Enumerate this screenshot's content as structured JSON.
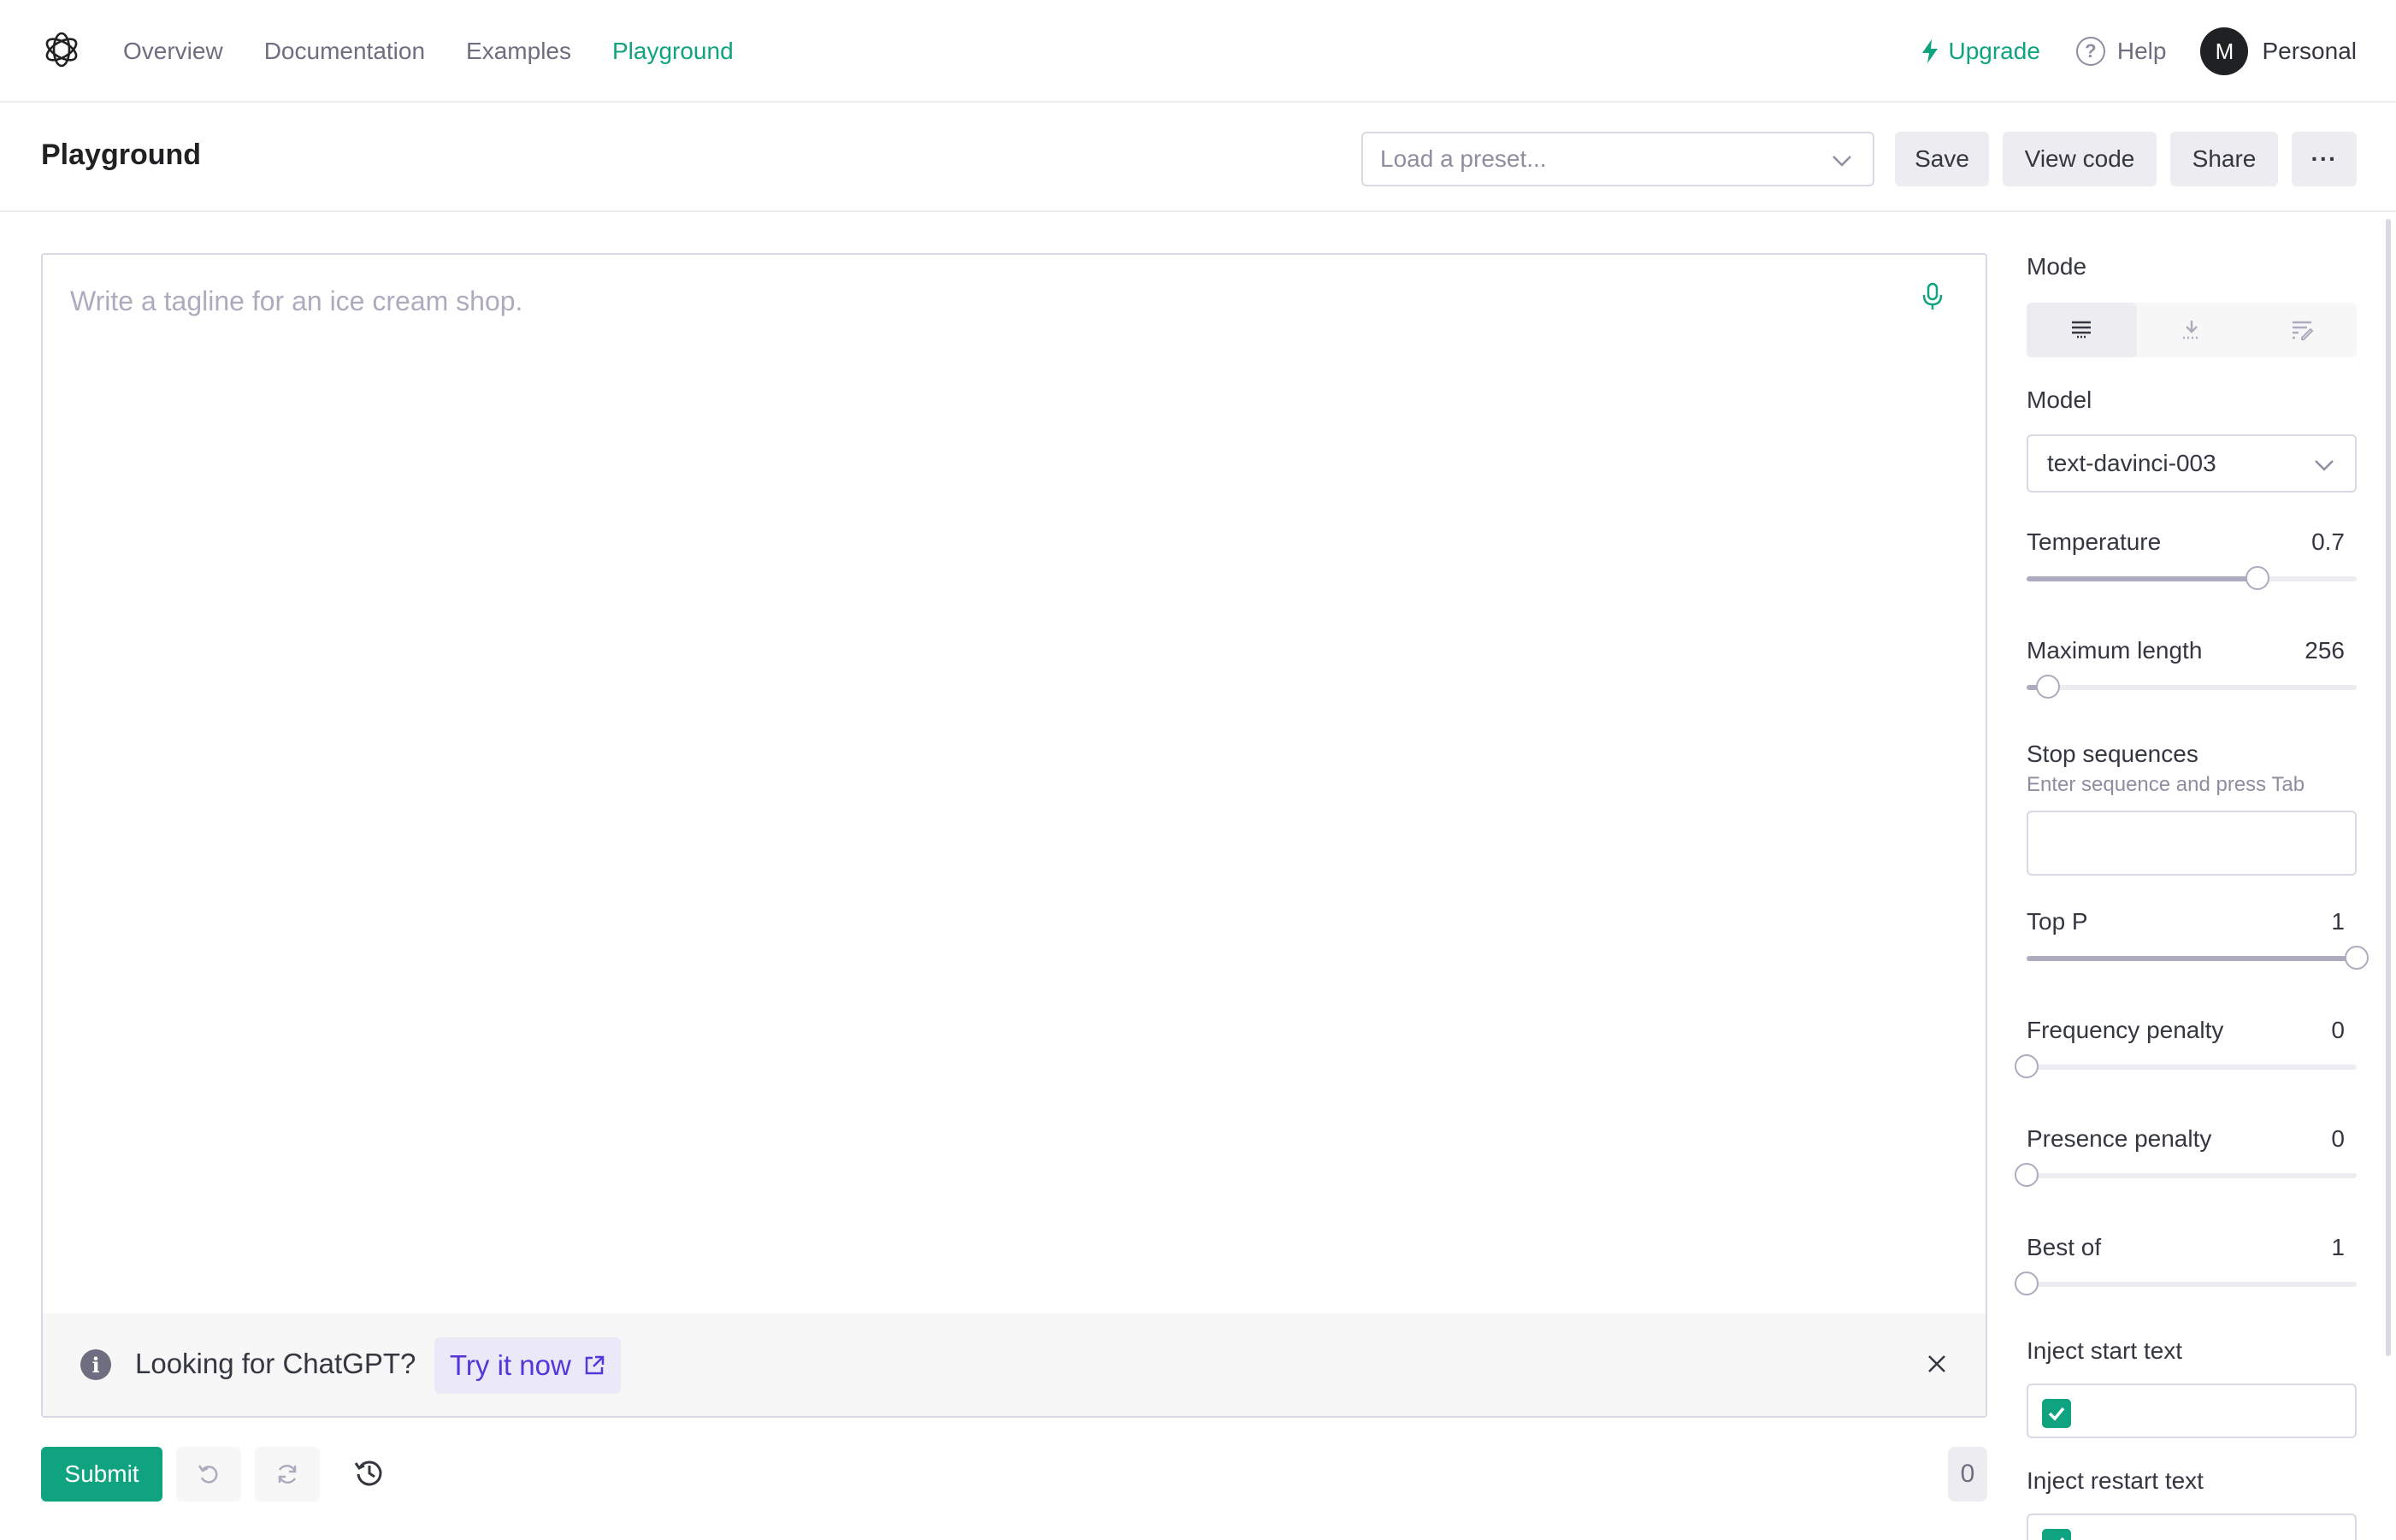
{
  "nav": {
    "links": [
      "Overview",
      "Documentation",
      "Examples",
      "Playground"
    ],
    "active": "Playground",
    "upgrade": "Upgrade",
    "help": "Help",
    "avatar_initial": "M",
    "account": "Personal"
  },
  "header": {
    "title": "Playground",
    "preset_placeholder": "Load a preset...",
    "save": "Save",
    "view_code": "View code",
    "share": "Share",
    "more": "···"
  },
  "editor": {
    "placeholder": "Write a tagline for an ice cream shop.",
    "banner_text": "Looking for ChatGPT?",
    "banner_link": "Try it now"
  },
  "footer": {
    "submit": "Submit",
    "token_count": "0"
  },
  "settings": {
    "mode_label": "Mode",
    "mode_icons": [
      "complete-mode-icon",
      "insert-mode-icon",
      "edit-mode-icon"
    ],
    "model_label": "Model",
    "model_value": "text-davinci-003",
    "temperature": {
      "label": "Temperature",
      "value": "0.7",
      "fraction": 0.7
    },
    "max_length": {
      "label": "Maximum length",
      "value": "256",
      "fraction": 0.064
    },
    "stop_sequences": {
      "label": "Stop sequences",
      "hint": "Enter sequence and press Tab"
    },
    "top_p": {
      "label": "Top P",
      "value": "1",
      "fraction": 1.0
    },
    "frequency_penalty": {
      "label": "Frequency penalty",
      "value": "0",
      "fraction": 0.0
    },
    "presence_penalty": {
      "label": "Presence penalty",
      "value": "0",
      "fraction": 0.0
    },
    "best_of": {
      "label": "Best of",
      "value": "1",
      "fraction": 0.0
    },
    "inject_start": {
      "label": "Inject start text",
      "checked": true
    },
    "inject_restart": {
      "label": "Inject restart text",
      "checked": true
    }
  },
  "colors": {
    "accent": "#10a37f",
    "link_purple": "#5436da",
    "text": "#353740",
    "muted": "#6e6e80"
  }
}
